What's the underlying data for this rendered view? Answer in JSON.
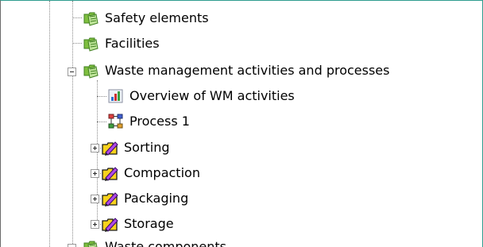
{
  "tree": {
    "items": [
      {
        "label": "Safety elements",
        "icon": "folder-book-icon"
      },
      {
        "label": "Facilities",
        "icon": "folder-book-icon"
      },
      {
        "label": "Waste management activities and processes",
        "icon": "folder-book-icon",
        "expanded": true
      },
      {
        "label": "Overview of WM activities",
        "icon": "bar-chart-icon"
      },
      {
        "label": "Process 1",
        "icon": "flow-diagram-icon"
      },
      {
        "label": "Sorting",
        "icon": "yellow-folder-pencil-icon",
        "expanded": false
      },
      {
        "label": "Compaction",
        "icon": "yellow-folder-pencil-icon",
        "expanded": false
      },
      {
        "label": "Packaging",
        "icon": "yellow-folder-pencil-icon",
        "expanded": false
      },
      {
        "label": "Storage",
        "icon": "yellow-folder-pencil-icon",
        "expanded": false
      },
      {
        "label": "Waste components",
        "icon": "folder-book-icon"
      }
    ]
  },
  "colors": {
    "panel_border": "#2f9d8f",
    "guide_line": "#8a8a8a",
    "folder_green": "#7fbf3f",
    "folder_yellow": "#f7d21c",
    "pencil_purple": "#8a2bd8"
  }
}
